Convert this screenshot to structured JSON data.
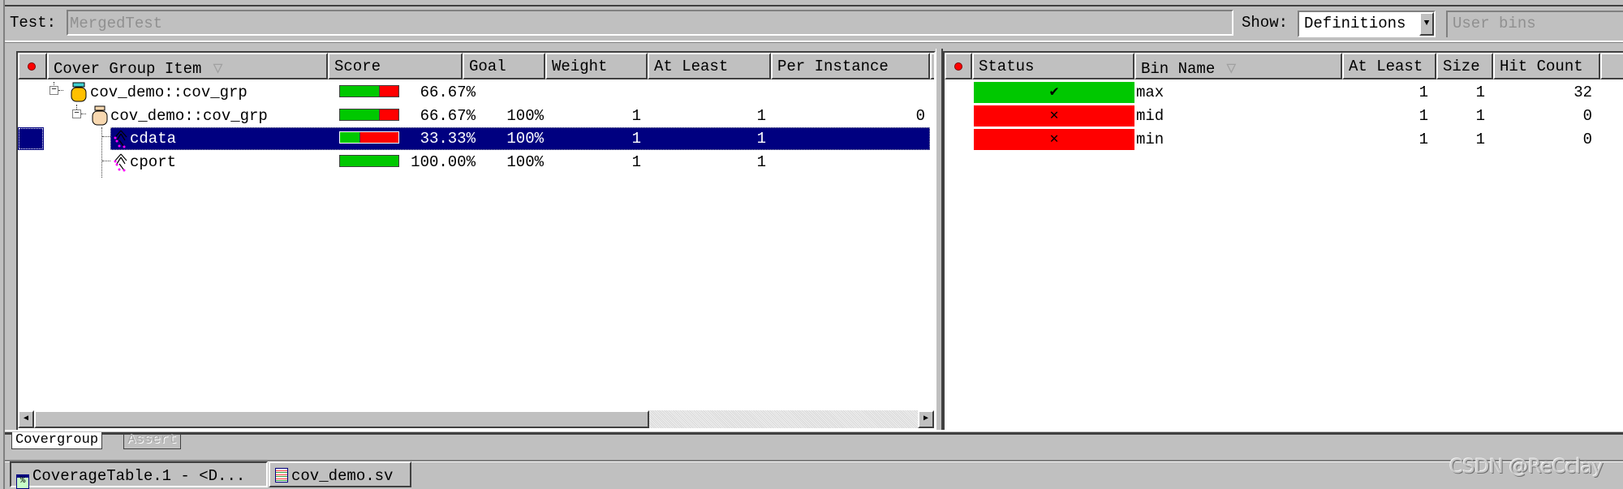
{
  "toolbar": {
    "test_label": "Test:",
    "test_value": "MergedTest",
    "show_label": "Show:",
    "show_value": "Definitions",
    "user_bins_placeholder": "User bins"
  },
  "left_table": {
    "columns": [
      "Cover Group Item",
      "Score",
      "Goal",
      "Weight",
      "At Least",
      "Per Instance"
    ],
    "rows": [
      {
        "name": "cov_demo::cov_grp",
        "icon": "covergroup-jar-icon",
        "score_pct": 66.67,
        "score": "66.67%",
        "goal": "",
        "weight": "",
        "at_least": "",
        "per_instance": "",
        "selected": false
      },
      {
        "name": "cov_demo::cov_grp",
        "icon": "covergroup-instance-jar-icon",
        "score_pct": 66.67,
        "score": "66.67%",
        "goal": "100%",
        "weight": "1",
        "at_least": "1",
        "per_instance": "0",
        "selected": false
      },
      {
        "name": "cdata",
        "icon": "coverpoint-icon",
        "score_pct": 33.33,
        "score": "33.33%",
        "goal": "100%",
        "weight": "1",
        "at_least": "1",
        "per_instance": "",
        "selected": true
      },
      {
        "name": "cport",
        "icon": "coverpoint-icon",
        "score_pct": 100.0,
        "score": "100.00%",
        "goal": "100%",
        "weight": "1",
        "at_least": "1",
        "per_instance": "",
        "selected": false
      }
    ]
  },
  "right_table": {
    "columns": [
      "Status",
      "Bin Name",
      "At Least",
      "Size",
      "Hit Count"
    ],
    "rows": [
      {
        "status": "covered",
        "status_glyph": "✔",
        "status_color": "#00c800",
        "bin_name": "max",
        "at_least": "1",
        "size": "1",
        "hit_count": "32"
      },
      {
        "status": "uncovered",
        "status_glyph": "✕",
        "status_color": "#ff0000",
        "bin_name": "mid",
        "at_least": "1",
        "size": "1",
        "hit_count": "0"
      },
      {
        "status": "uncovered",
        "status_glyph": "✕",
        "status_color": "#ff0000",
        "bin_name": "min",
        "at_least": "1",
        "size": "1",
        "hit_count": "0"
      }
    ]
  },
  "tabs": [
    {
      "label": "Covergroup",
      "active": true
    },
    {
      "label": "Assert",
      "active": false
    }
  ],
  "taskbar": [
    {
      "label": "CoverageTable.1 - <D...",
      "icon": "coverage-table-icon",
      "active": true
    },
    {
      "label": "cov_demo.sv",
      "icon": "source-file-icon",
      "active": false
    }
  ],
  "watermark": "CSDN @ReCclay",
  "colors": {
    "covered": "#00c800",
    "uncovered": "#ff0000",
    "selection": "#000080"
  }
}
